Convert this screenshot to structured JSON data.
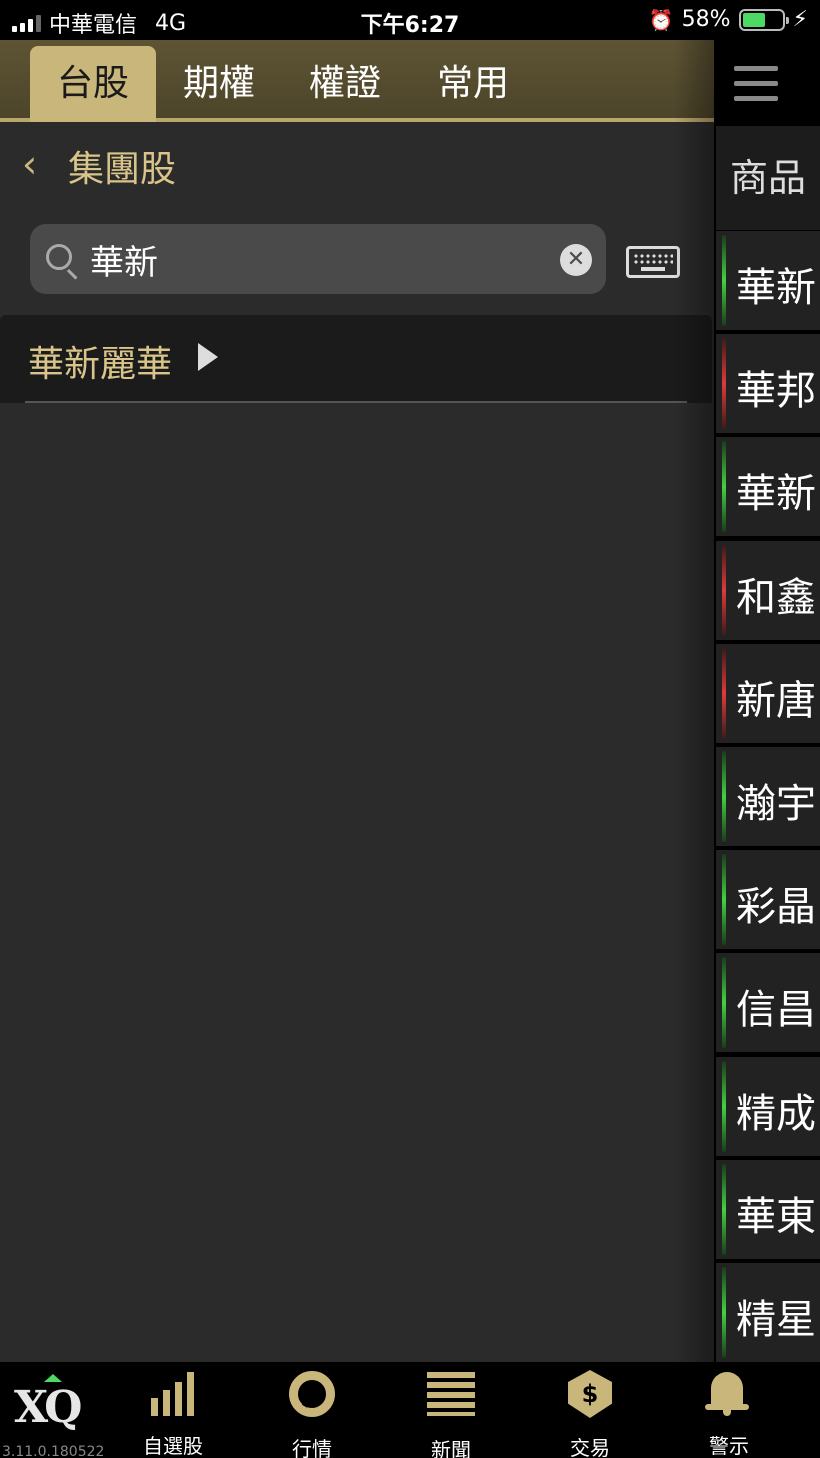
{
  "status_bar": {
    "carrier": "中華電信",
    "network": "4G",
    "time": "下午6:27",
    "battery": "58%",
    "battery_level": 0.58
  },
  "tabs": [
    {
      "label": "台股",
      "active": true
    },
    {
      "label": "期權",
      "active": false
    },
    {
      "label": "權證",
      "active": false
    },
    {
      "label": "常用",
      "active": false
    }
  ],
  "nav_title": "集團股",
  "search": {
    "value": "華新",
    "placeholder": ""
  },
  "results": [
    {
      "label": "華新麗華"
    }
  ],
  "rail": {
    "header": "商品",
    "items": [
      {
        "name": "華新",
        "trend": "green"
      },
      {
        "name": "華邦",
        "trend": "red"
      },
      {
        "name": "華新",
        "trend": "green"
      },
      {
        "name": "和鑫",
        "trend": "red"
      },
      {
        "name": "新唐",
        "trend": "red"
      },
      {
        "name": "瀚宇",
        "trend": "green"
      },
      {
        "name": "彩晶",
        "trend": "green"
      },
      {
        "name": "信昌",
        "trend": "green"
      },
      {
        "name": "精成",
        "trend": "green"
      },
      {
        "name": "華東",
        "trend": "green"
      },
      {
        "name": "精星",
        "trend": "green"
      }
    ]
  },
  "bottom_nav": {
    "logo": "XQ",
    "version": "3.11.0.180522",
    "items": [
      {
        "label": "自選股",
        "icon": "watchlist-chart-icon"
      },
      {
        "label": "行情",
        "icon": "market-ring-icon"
      },
      {
        "label": "新聞",
        "icon": "news-icon"
      },
      {
        "label": "交易",
        "icon": "trade-dollar-icon"
      },
      {
        "label": "警示",
        "icon": "bell-icon"
      }
    ]
  },
  "colors": {
    "accent_gold": "#c8b67a",
    "up_green": "#42d142",
    "down_red": "#e03a3a",
    "panel_bg": "#2b2b2b"
  }
}
